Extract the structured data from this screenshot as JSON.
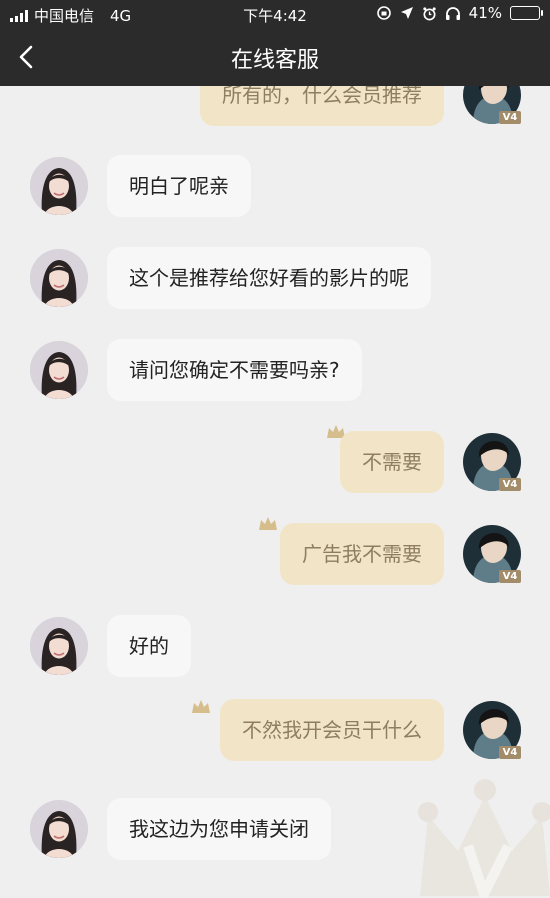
{
  "status": {
    "carrier": "中国电信",
    "network": "4G",
    "time": "下午4:42",
    "battery": "41%",
    "battery_level": 0.41
  },
  "nav": {
    "title": "在线客服",
    "back_icon": "chevron-left-icon"
  },
  "colors": {
    "bar": "#2b2b2b",
    "chat_bg": "#f0efef",
    "bubble_left": "#f7f7f7",
    "bubble_right": "#f2e4c6",
    "bubble_right_text": "#8e7d62",
    "crown": "#d6bd8c"
  },
  "messages": [
    {
      "side": "right",
      "text": "所有的，什么会员推荐",
      "badge": "V4"
    },
    {
      "side": "left",
      "text": "明白了呢亲"
    },
    {
      "side": "left",
      "text": "这个是推荐给您好看的影片的呢"
    },
    {
      "side": "left",
      "text": "请问您确定不需要吗亲?"
    },
    {
      "side": "right",
      "text": "不需要",
      "badge": "V4"
    },
    {
      "side": "right",
      "text": "广告我不需要",
      "badge": "V4"
    },
    {
      "side": "left",
      "text": "好的"
    },
    {
      "side": "right",
      "text": "不然我开会员干什么",
      "badge": "V4"
    },
    {
      "side": "left",
      "text": "我这边为您申请关闭"
    }
  ]
}
